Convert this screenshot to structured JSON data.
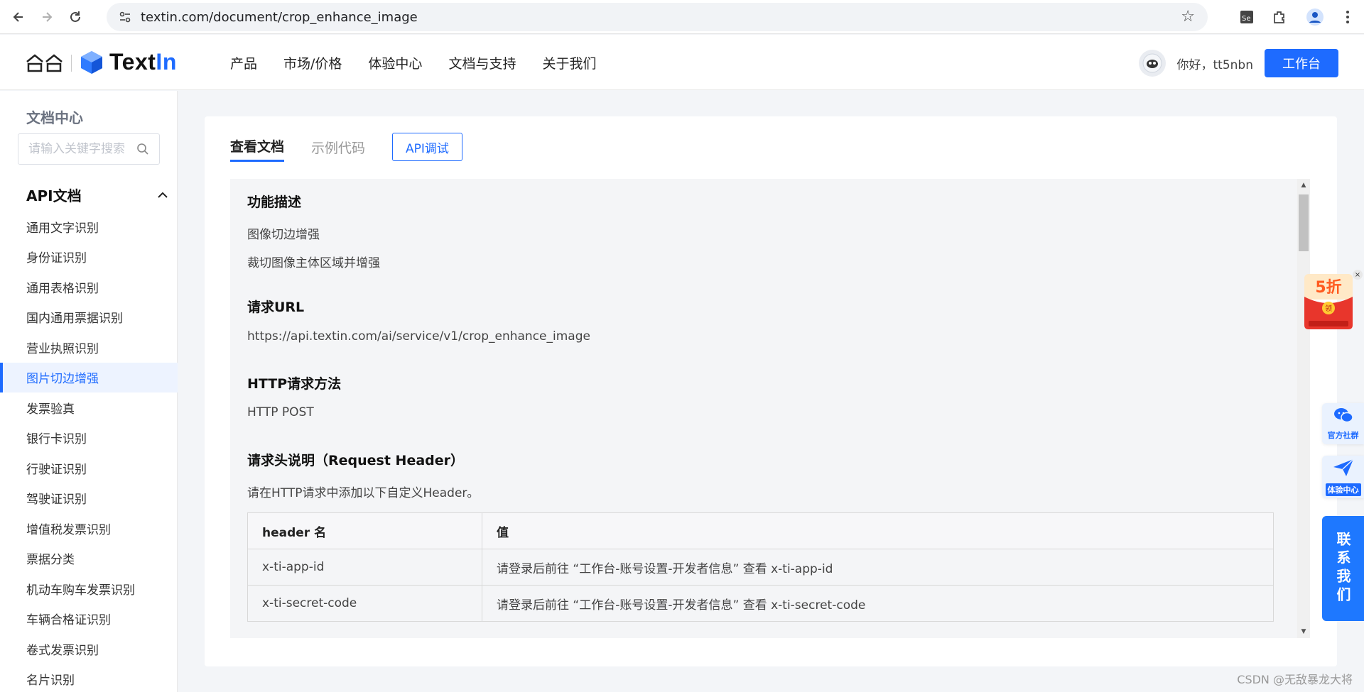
{
  "browser": {
    "url": "textin.com/document/crop_enhance_image"
  },
  "header": {
    "brand": {
      "name_main": "Text",
      "name_accent": "In"
    },
    "nav": [
      "产品",
      "市场/价格",
      "体验中心",
      "文档与支持",
      "关于我们"
    ],
    "greeting": "你好，tt5nbn",
    "workbench_label": "工作台"
  },
  "sidebar": {
    "title": "文档中心",
    "search_placeholder": "请输入关键字搜索",
    "section_label": "API文档",
    "items": [
      "通用文字识别",
      "身份证识别",
      "通用表格识别",
      "国内通用票据识别",
      "营业执照识别",
      "图片切边增强",
      "发票验真",
      "银行卡识别",
      "行驶证识别",
      "驾驶证识别",
      "增值税发票识别",
      "票据分类",
      "机动车购车发票识别",
      "车辆合格证识别",
      "卷式发票识别",
      "名片识别"
    ],
    "active_index": 5
  },
  "tabs": {
    "doc_label": "查看文档",
    "code_label": "示例代码",
    "api_label": "API调试"
  },
  "doc": {
    "h_func": "功能描述",
    "func_1": "图像切边增强",
    "func_2": "裁切图像主体区域并增强",
    "h_url": "请求URL",
    "url": "https://api.textin.com/ai/service/v1/crop_enhance_image",
    "h_method": "HTTP请求方法",
    "method": "HTTP POST",
    "h_header": "请求头说明（Request Header）",
    "header_desc": "请在HTTP请求中添加以下自定义Header。",
    "table": {
      "col1": "header 名",
      "col2": "值",
      "rows": [
        {
          "name": "x-ti-app-id",
          "value": "请登录后前往 “工作台-账号设置-开发者信息” 查看 x-ti-app-id"
        },
        {
          "name": "x-ti-secret-code",
          "value": "请登录后前往 “工作台-账号设置-开发者信息” 查看 x-ti-secret-code"
        }
      ]
    }
  },
  "floating": {
    "promo_discount": "5折",
    "promo_badge": "领",
    "community_label": "官方社群",
    "experience_label": "体验中心",
    "contact_label": "联系我们"
  },
  "watermark": "CSDN @无敌暴龙大将",
  "colors": {
    "accent": "#1e6bff",
    "active_bg": "#edf3ff"
  }
}
